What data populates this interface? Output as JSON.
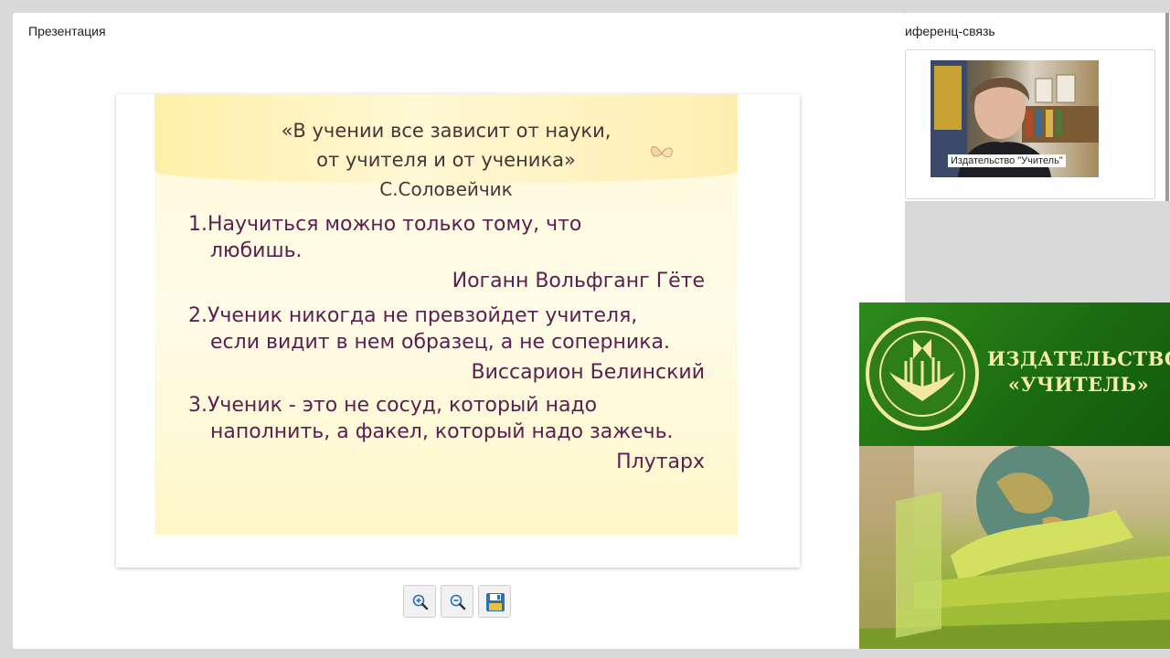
{
  "presentation": {
    "title": "Презентация",
    "slide": {
      "epigraph_line1": "«В учении все зависит от науки,",
      "epigraph_line2": "от учителя и от ученика»",
      "epigraph_author": "С.Соловейчик",
      "quotes": [
        {
          "line1": "1.Научиться можно только тому, что",
          "line2": "любишь.",
          "author": "Иоганн Вольфганг Гёте"
        },
        {
          "line1": "2.Ученик никогда не превзойдет учителя,",
          "line2": "если видит в нем образец, а не соперника.",
          "author": "Виссарион Белинский"
        },
        {
          "line1": "3.Ученик - это не сосуд, который надо",
          "line2": "наполнить, а факел, который надо зажечь.",
          "author": "Плутарх"
        }
      ]
    },
    "toolbar": {
      "zoom_in_icon": "zoom-in-icon",
      "zoom_out_icon": "zoom-out-icon",
      "save_icon": "save-icon"
    }
  },
  "conference": {
    "title": "иференц-связь",
    "video_caption": "Издательство \"Учитель\""
  },
  "banner": {
    "line1": "ИЗДАТЕЛЬСТВО",
    "line2": "«УЧИТЕЛЬ»",
    "colors": {
      "green": "#1f7412",
      "gold": "#f2e8a0"
    }
  }
}
